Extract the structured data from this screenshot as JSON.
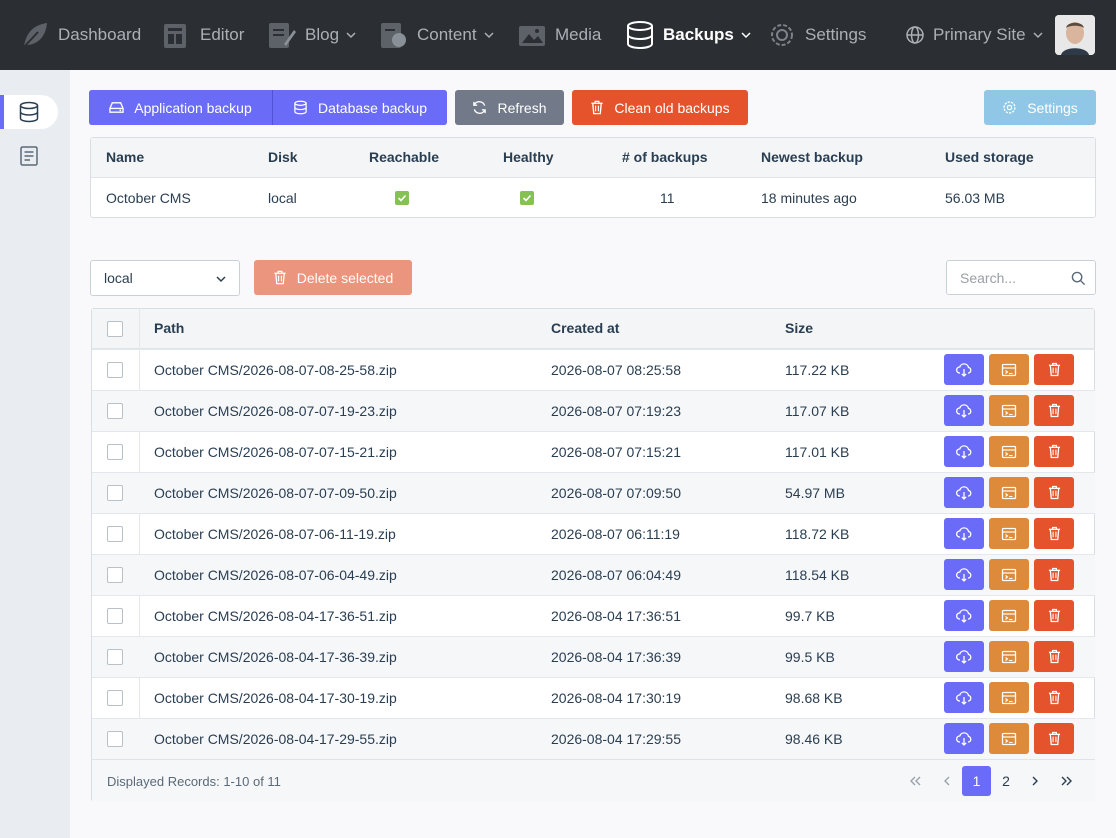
{
  "nav": {
    "items": [
      {
        "label": "Dashboard",
        "icon": "leaf-icon"
      },
      {
        "label": "Editor",
        "icon": "editor-icon"
      },
      {
        "label": "Blog",
        "icon": "blog-icon"
      },
      {
        "label": "Content",
        "icon": "content-icon"
      },
      {
        "label": "Media",
        "icon": "media-icon"
      },
      {
        "label": "Backups",
        "icon": "database-icon"
      },
      {
        "label": "Settings",
        "icon": "gear-icon"
      }
    ],
    "site": "Primary Site",
    "active": "Backups"
  },
  "sidebar": {
    "items": [
      {
        "icon": "database-icon",
        "active": true
      },
      {
        "icon": "document-icon",
        "active": false
      }
    ]
  },
  "toolbar": {
    "app_backup": "Application backup",
    "db_backup": "Database backup",
    "refresh": "Refresh",
    "clean": "Clean old backups",
    "settings": "Settings"
  },
  "summary": {
    "headers": [
      "Name",
      "Disk",
      "Reachable",
      "Healthy",
      "# of backups",
      "Newest backup",
      "Used storage"
    ],
    "row": {
      "name": "October CMS",
      "disk": "local",
      "reachable": true,
      "healthy": true,
      "count": "11",
      "newest": "18 minutes ago",
      "storage": "56.03 MB"
    }
  },
  "filter": {
    "disk": "local",
    "delete_selected": "Delete selected",
    "search_placeholder": "Search..."
  },
  "backups": {
    "headers": {
      "path": "Path",
      "created": "Created at",
      "size": "Size"
    },
    "rows": [
      {
        "path": "October CMS/2026-08-07-08-25-58.zip",
        "created": "2026-08-07 08:25:58",
        "size": "117.22 KB"
      },
      {
        "path": "October CMS/2026-08-07-07-19-23.zip",
        "created": "2026-08-07 07:19:23",
        "size": "117.07 KB"
      },
      {
        "path": "October CMS/2026-08-07-07-15-21.zip",
        "created": "2026-08-07 07:15:21",
        "size": "117.01 KB"
      },
      {
        "path": "October CMS/2026-08-07-07-09-50.zip",
        "created": "2026-08-07 07:09:50",
        "size": "54.97 MB"
      },
      {
        "path": "October CMS/2026-08-07-06-11-19.zip",
        "created": "2026-08-07 06:11:19",
        "size": "118.72 KB"
      },
      {
        "path": "October CMS/2026-08-07-06-04-49.zip",
        "created": "2026-08-07 06:04:49",
        "size": "118.54 KB"
      },
      {
        "path": "October CMS/2026-08-04-17-36-51.zip",
        "created": "2026-08-04 17:36:51",
        "size": "99.7 KB"
      },
      {
        "path": "October CMS/2026-08-04-17-36-39.zip",
        "created": "2026-08-04 17:36:39",
        "size": "99.5 KB"
      },
      {
        "path": "October CMS/2026-08-04-17-30-19.zip",
        "created": "2026-08-04 17:30:19",
        "size": "98.68 KB"
      },
      {
        "path": "October CMS/2026-08-04-17-29-55.zip",
        "created": "2026-08-04 17:29:55",
        "size": "98.46 KB"
      }
    ],
    "footer": "Displayed Records: 1-10 of 11",
    "pages": [
      "1",
      "2"
    ],
    "current_page": "1"
  },
  "colors": {
    "accent": "#6a6cf7",
    "danger": "#e5532c",
    "warning": "#dd8a3b",
    "nav_bg": "#2b2f33"
  }
}
